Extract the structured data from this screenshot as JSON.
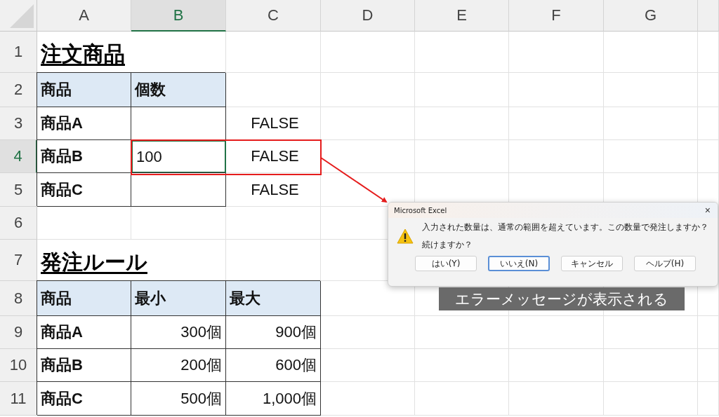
{
  "sheet": {
    "columns": [
      {
        "label": "A",
        "selected": false
      },
      {
        "label": "B",
        "selected": true
      },
      {
        "label": "C",
        "selected": false
      },
      {
        "label": "D",
        "selected": false
      },
      {
        "label": "E",
        "selected": false
      },
      {
        "label": "F",
        "selected": false
      },
      {
        "label": "G",
        "selected": false
      }
    ],
    "rows": [
      {
        "label": "1",
        "selected": false,
        "cells": [
          {
            "kind": "title",
            "text": "注文商品",
            "selected": false
          },
          {
            "kind": "blank",
            "selected": false
          },
          {
            "kind": "blank",
            "selected": false
          }
        ]
      },
      {
        "label": "2",
        "selected": false,
        "cells": [
          {
            "kind": "header",
            "text": "商品",
            "selected": false
          },
          {
            "kind": "header",
            "text": "個数",
            "selected": false
          },
          {
            "kind": "blank",
            "selected": false
          }
        ]
      },
      {
        "label": "3",
        "selected": false,
        "cells": [
          {
            "kind": "label",
            "text": "商品A",
            "selected": false
          },
          {
            "kind": "input",
            "selected": false
          },
          {
            "kind": "logical",
            "text": "FALSE",
            "selected": false
          }
        ]
      },
      {
        "label": "4",
        "selected": true,
        "cells": [
          {
            "kind": "label",
            "text": "商品B",
            "selected": false
          },
          {
            "kind": "input",
            "text": "100",
            "selected": true
          },
          {
            "kind": "logical",
            "text": "FALSE",
            "selected": false
          }
        ]
      },
      {
        "label": "5",
        "selected": false,
        "cells": [
          {
            "kind": "label",
            "text": "商品C",
            "selected": false
          },
          {
            "kind": "input",
            "selected": false
          },
          {
            "kind": "logical",
            "text": "FALSE",
            "selected": false
          }
        ]
      },
      {
        "label": "6",
        "selected": false,
        "cells": [
          {
            "kind": "blank",
            "selected": false
          },
          {
            "kind": "blank",
            "selected": false
          },
          {
            "kind": "blank",
            "selected": false
          }
        ]
      },
      {
        "label": "7",
        "selected": false,
        "cells": [
          {
            "kind": "title",
            "text": "発注ルール",
            "selected": false
          },
          {
            "kind": "blank",
            "selected": false
          },
          {
            "kind": "blank",
            "selected": false
          }
        ]
      },
      {
        "label": "8",
        "selected": false,
        "cells": [
          {
            "kind": "header",
            "text": "商品",
            "selected": false
          },
          {
            "kind": "header",
            "text": "最小",
            "selected": false
          },
          {
            "kind": "header",
            "text": "最大",
            "selected": false
          }
        ]
      },
      {
        "label": "9",
        "selected": false,
        "cells": [
          {
            "kind": "label",
            "text": "商品A",
            "selected": false
          },
          {
            "kind": "number",
            "text": "300個",
            "selected": false
          },
          {
            "kind": "number",
            "text": "900個",
            "selected": false
          }
        ]
      },
      {
        "label": "10",
        "selected": false,
        "cells": [
          {
            "kind": "label",
            "text": "商品B",
            "selected": false
          },
          {
            "kind": "number",
            "text": "200個",
            "selected": false
          },
          {
            "kind": "number",
            "text": "600個",
            "selected": false
          }
        ]
      },
      {
        "label": "11",
        "selected": false,
        "cells": [
          {
            "kind": "label",
            "text": "商品C",
            "selected": false
          },
          {
            "kind": "number",
            "text": "500個",
            "selected": false
          },
          {
            "kind": "number",
            "text": "1,000個",
            "selected": false
          }
        ]
      }
    ]
  },
  "dialog": {
    "title": "Microsoft Excel",
    "close": "×",
    "message": "入力された数量は、通常の範囲を超えています。この数量で発注しますか？",
    "question": "続けますか？",
    "buttons": [
      {
        "label": "はい(Y)",
        "selected": false
      },
      {
        "label": "いいえ(N)",
        "selected": true
      },
      {
        "label": "キャンセル",
        "selected": false
      },
      {
        "label": "ヘルプ(H)",
        "selected": false
      }
    ]
  },
  "caption": "エラーメッセージが表示される"
}
